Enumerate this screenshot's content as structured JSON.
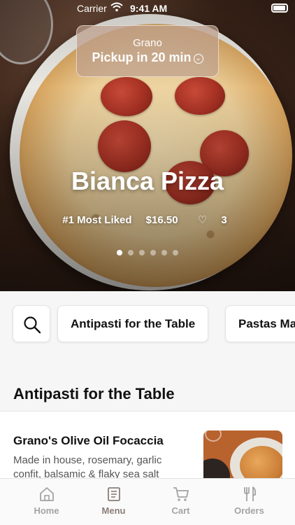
{
  "status_bar": {
    "carrier": "Carrier",
    "time": "9:41 AM"
  },
  "pickup": {
    "store": "Grano",
    "label": "Pickup in 20 min"
  },
  "featured": {
    "title": "Bianca Pizza",
    "badge": "#1 Most Liked",
    "price": "$16.50",
    "likes": "3",
    "carousel_index": 1,
    "carousel_count": 6
  },
  "categories": [
    "Antipasti for the Table",
    "Pastas Ma"
  ],
  "section": {
    "title": "Antipasti for the Table"
  },
  "items": [
    {
      "name": "Grano's Olive Oil Focaccia",
      "description": "Made in house, rosemary, garlic confit, balsamic & flaky sea salt"
    }
  ],
  "tabs": [
    {
      "label": "Home",
      "icon": "home-icon",
      "active": false
    },
    {
      "label": "Menu",
      "icon": "menu-book-icon",
      "active": true
    },
    {
      "label": "Cart",
      "icon": "cart-icon",
      "active": false
    },
    {
      "label": "Orders",
      "icon": "fork-knife-icon",
      "active": false
    }
  ],
  "colors": {
    "active_tab": "#8b7e78",
    "inactive_tab": "#a3a3a3"
  }
}
